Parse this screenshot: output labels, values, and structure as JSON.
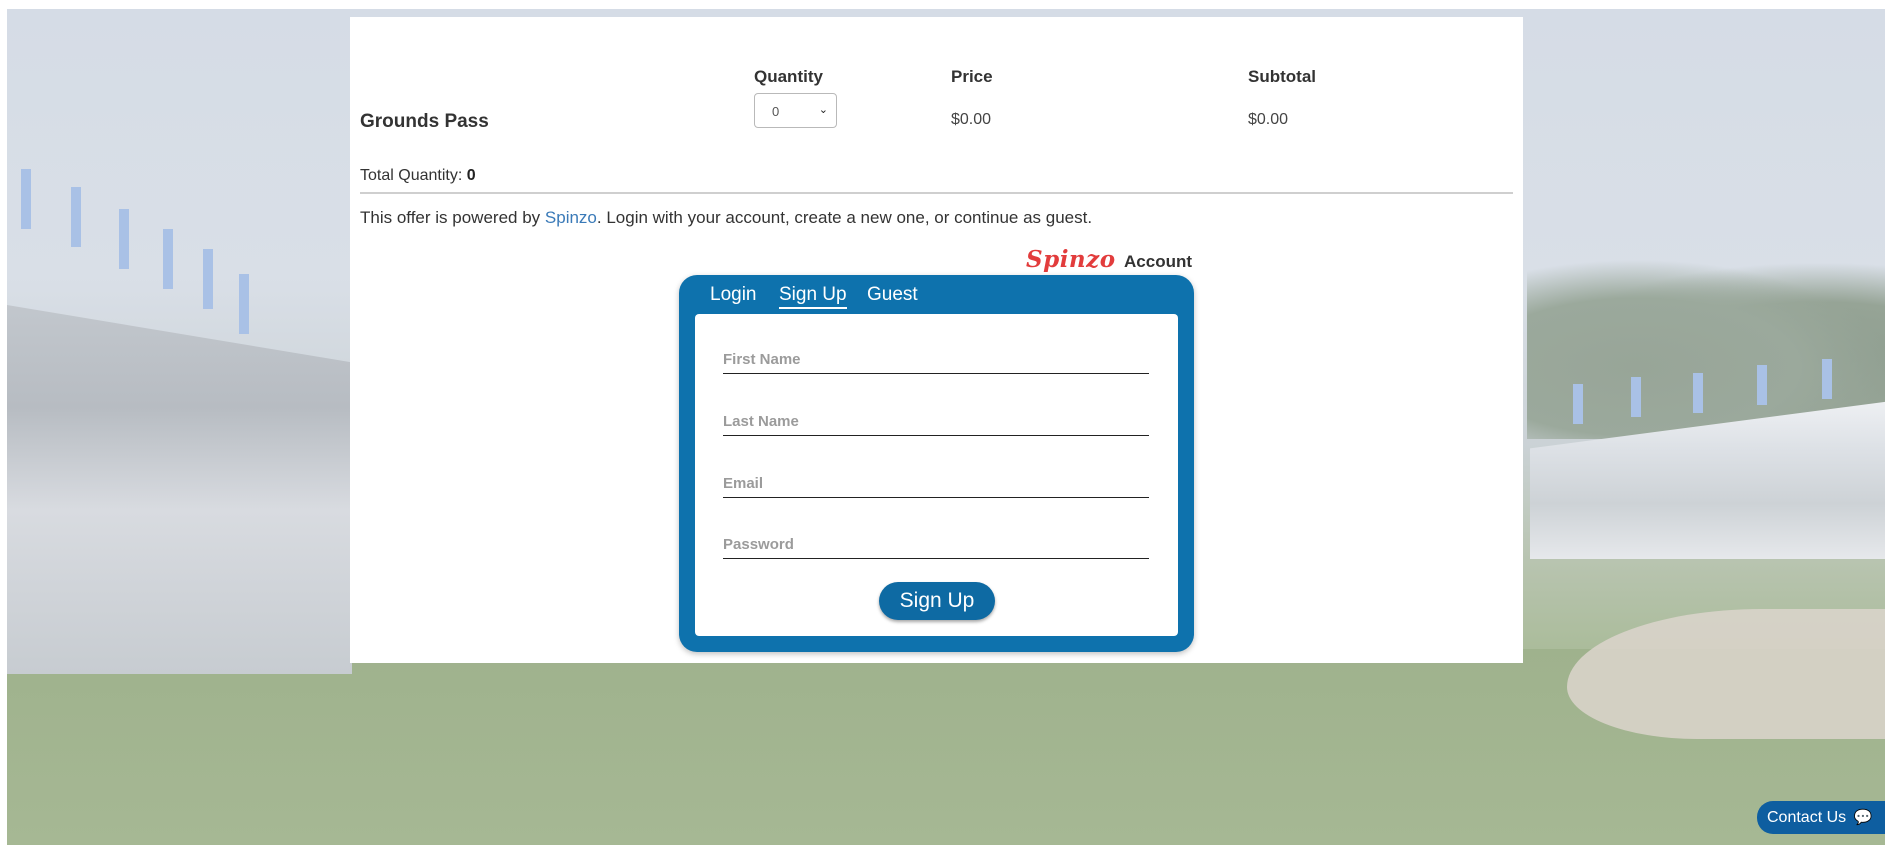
{
  "table": {
    "headers": {
      "quantity": "Quantity",
      "price": "Price",
      "subtotal": "Subtotal"
    },
    "rows": [
      {
        "name": "Grounds Pass",
        "quantity": "0",
        "price": "$0.00",
        "subtotal": "$0.00"
      }
    ]
  },
  "totals": {
    "label": "Total Quantity:",
    "value": "0"
  },
  "powered": {
    "prefix": "This offer is powered by",
    "link": "Spinzo",
    "suffix": ". Login with your account, create a new one, or continue as guest."
  },
  "account": {
    "brand": "Spinzo",
    "word": "Account",
    "tabs": [
      "Login",
      "Sign Up",
      "Guest"
    ],
    "active_tab": "Sign Up",
    "fields": [
      {
        "placeholder": "First Name"
      },
      {
        "placeholder": "Last Name"
      },
      {
        "placeholder": "Email"
      },
      {
        "placeholder": "Password"
      }
    ],
    "submit_label": "Sign Up"
  },
  "contact": {
    "label": "Contact Us",
    "icon": "chat-icon"
  },
  "colors": {
    "accent": "#0e72ad",
    "brand_red": "#e23c3c",
    "link": "#3a7ab8"
  }
}
